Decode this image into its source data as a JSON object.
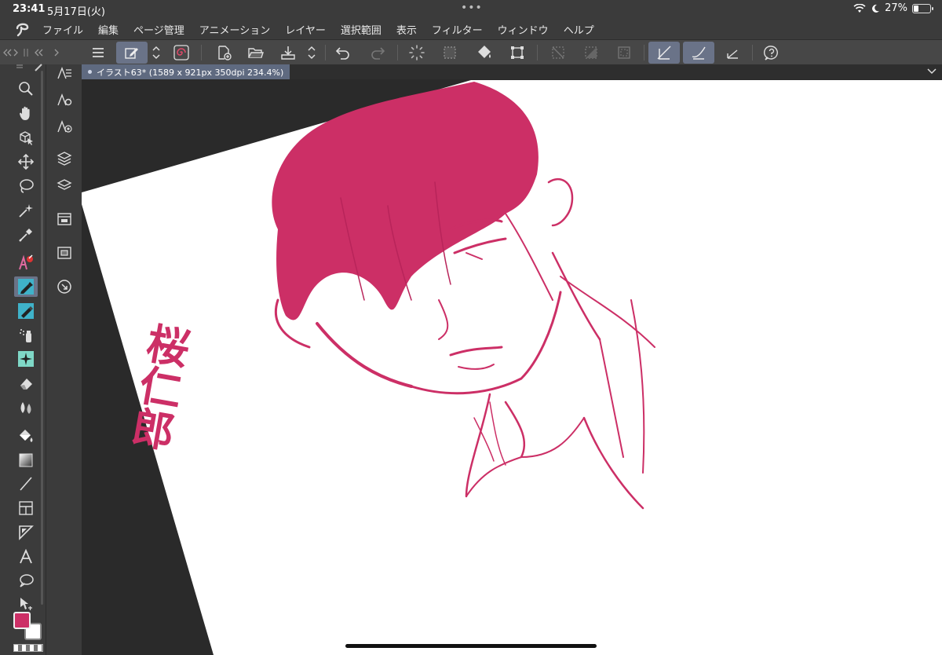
{
  "status": {
    "time": "23:41",
    "date": "5月17日(火)",
    "battery_text": "27%",
    "battery_level": 0.27,
    "more_dots": "•••"
  },
  "menu": [
    "ファイル",
    "編集",
    "ページ管理",
    "アニメーション",
    "レイヤー",
    "選択範囲",
    "表示",
    "フィルター",
    "ウィンドウ",
    "ヘルプ"
  ],
  "document": {
    "tab_label": "イラスト63* (1589 x 921px 350dpi 234.4%)"
  },
  "colors": {
    "main": "#cc2f66",
    "sub": "#ffffff",
    "active_tool_bg": "#6a7388",
    "ui_bg": "#3b3b3b",
    "toolbar_bg": "#474747",
    "canvas_bg": "#2a2a2a"
  },
  "artwork_text": "桜仁郎",
  "toolbar": [
    "menu",
    "canvas-edit",
    "cycle",
    "spiral",
    "new-page",
    "open",
    "save",
    "cycle",
    "undo",
    "redo",
    "loading",
    "select-all",
    "fill",
    "transform",
    "deselect",
    "invert",
    "border",
    "snap-line",
    "snap-ruler",
    "snap-special",
    "help"
  ],
  "tools": [
    "zoom",
    "hand",
    "object",
    "move",
    "lasso",
    "magic-wand",
    "eyedropper",
    "pen-color",
    "pen",
    "pencil",
    "airbrush",
    "decoration",
    "eraser",
    "blend",
    "fill",
    "gradient",
    "line",
    "frame",
    "ruler",
    "text",
    "balloon",
    "correction"
  ]
}
